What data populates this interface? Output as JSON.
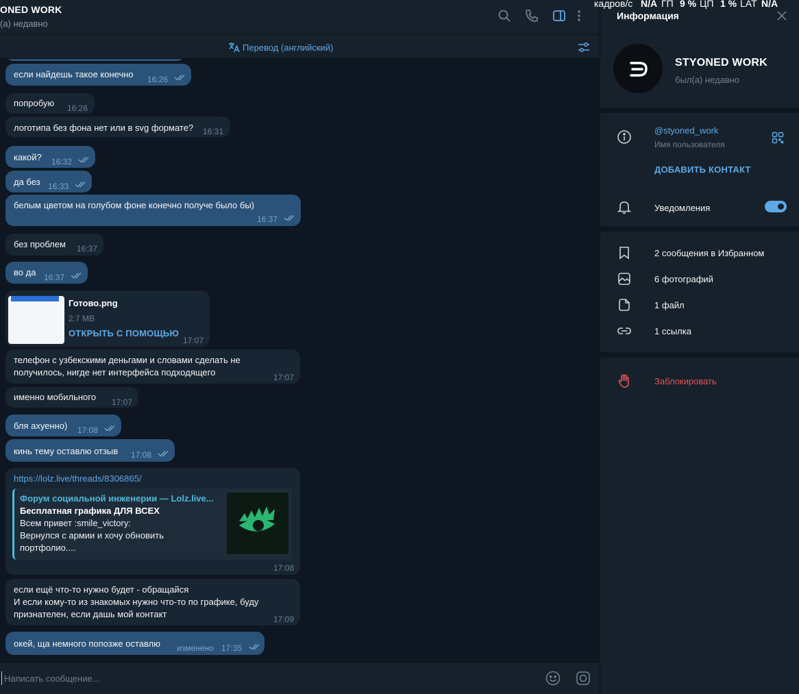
{
  "chat_header": {
    "title": "ONED WORK",
    "status": "(а) недавно"
  },
  "translate_bar": {
    "label": "Перевод (английский)"
  },
  "messages": [
    {
      "text": "если найдешь такое конечно",
      "time": "16:26"
    },
    {
      "text": "попробую",
      "time": "16:26"
    },
    {
      "text": "логотипа без фона нет или в svg формате?",
      "time": "16:31"
    },
    {
      "text": "какой?",
      "time": "16:32"
    },
    {
      "text": "да без",
      "time": "16:33"
    },
    {
      "text": "белым цветом на голубом фоне конечно получе было бы)",
      "time": "16:37"
    },
    {
      "text": "без проблем",
      "time": "16:37"
    },
    {
      "text": "во да",
      "time": "16:37"
    },
    {
      "file_name": "Готово.png",
      "file_size": "2.7 MB",
      "open_label": "ОТКРЫТЬ С ПОМОЩЬЮ",
      "time": "17:07"
    },
    {
      "text": "телефон с узбекскими деньгами и словами сделать не\nполучилось, нигде нет интерфейса подходящего",
      "time": "17:07"
    },
    {
      "text": "именно мобильного",
      "time": "17:07"
    },
    {
      "text": "бля ахуенно)",
      "time": "17:08"
    },
    {
      "text": "кинь тему оставлю отзыв",
      "time": "17:08"
    },
    {
      "url": "https://lolz.live/threads/8306865/",
      "preview": {
        "site": "Форум социальной инженерии — Lolz.live...",
        "title": "Бесплатная графика ДЛЯ ВСЕХ",
        "description": "Всем привет :smile_victory:\nВернулся с армии и хочу обновить\nпортфолио...."
      },
      "time": "17:08"
    },
    {
      "text": "если ещё что-то нужно будет - обращайся\nИ если кому-то из знакомых нужно что-то по графике, буду\nпризнателен, если дашь мой контакт",
      "time": "17:09"
    },
    {
      "text": "окей, ща немного попозже оставлю",
      "edited_label": "изменено",
      "time": "17:35"
    }
  ],
  "composer": {
    "placeholder": "Написать сообщение..."
  },
  "overlay": {
    "fps_label": "кадров/с",
    "fps_value": "N/A",
    "gpu_label": "ГП",
    "gpu_value": "9 %",
    "cpu_label": "ЦП",
    "cpu_value": "1 %",
    "lat_label": "LAT",
    "lat_value": "N/A"
  },
  "info_panel": {
    "title": "Информация",
    "name": "STYONED WORK",
    "status": "был(а) недавно",
    "username": "@styoned_work",
    "username_label": "Имя пользователя",
    "add_contact": "ДОБАВИТЬ КОНТАКТ",
    "notifications_label": "Уведомления",
    "notifications_enabled": true,
    "media": [
      {
        "label": "2 сообщения в Избранном",
        "icon": "bookmark-icon"
      },
      {
        "label": "6 фотографий",
        "icon": "photo-icon"
      },
      {
        "label": "1 файл",
        "icon": "file-icon"
      },
      {
        "label": "1 ссылка",
        "icon": "link-icon"
      }
    ],
    "block_label": "Заблокировать"
  },
  "colors": {
    "accent": "#5ea8e6",
    "outgoing_bubble": "#2b5278",
    "incoming_bubble": "#182533",
    "danger": "#e0535a"
  }
}
